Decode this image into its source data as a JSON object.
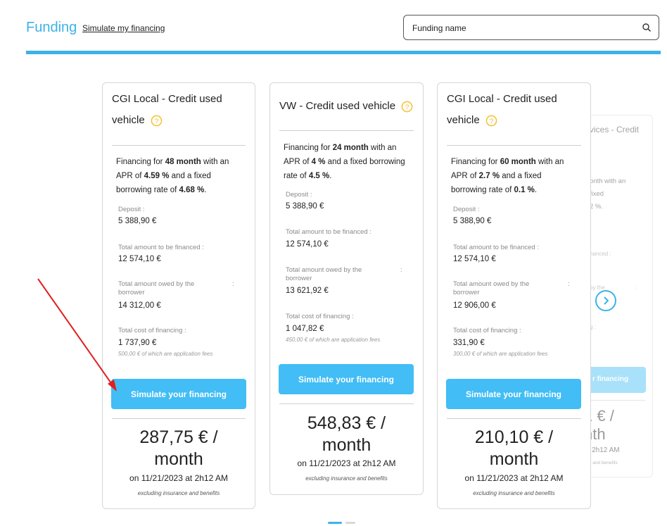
{
  "header": {
    "title": "Funding",
    "simulate_link": "Simulate my financing",
    "search_placeholder": "Funding name"
  },
  "colors": {
    "accent": "#3db2e8",
    "button": "#42bdf5",
    "help_icon": "#f2c12e",
    "arrow": "#e02020"
  },
  "labels": {
    "deposit": "Deposit :",
    "total_financed": "Total amount to be financed :",
    "total_owed_1": "Total amount owed by the",
    "total_owed_2": "borrower",
    "total_owed_colon": ":",
    "cost": "Total cost of financing :",
    "button": "Simulate your financing",
    "exclusion": "excluding insurance and benefits",
    "month": "month"
  },
  "cards": [
    {
      "title_line1": "CGI Local - Credit used",
      "title_line2": "vehicle",
      "months": "48 month",
      "apr": "4.59 %",
      "rate": "4.68 %",
      "deposit": "5 388,90 €",
      "financed": "12 574,10 €",
      "owed": "14 312,00 €",
      "cost": "1 737,90 €",
      "fees_note": "500,00 € of which are application fees",
      "price": "287,75 € /",
      "date": "on 11/21/2023 at 2h12 AM"
    },
    {
      "title_line1": "VW - Credit used vehicle",
      "months": "24 month",
      "apr": "4 %",
      "rate": "4.5 %",
      "deposit": "5 388,90 €",
      "financed": "12 574,10 €",
      "owed": "13 621,92 €",
      "cost": "1 047,82 €",
      "fees_note": "450,00 € of which are application fees",
      "price": "548,83 € /",
      "date": "on 11/21/2023 at 2h12 AM"
    },
    {
      "title_line1": "CGI Local - Credit used",
      "title_line2": "vehicle",
      "months": "60 month",
      "apr": "2.7 %",
      "rate": "0.1 %",
      "deposit": "5 388,90 €",
      "financed": "12 574,10 €",
      "owed": "12 906,00 €",
      "cost": "331,90 €",
      "fees_note": "300,00 € of which are application fees",
      "price": "210,10 € /",
      "date": "on 11/21/2023 at 2h12 AM"
    }
  ],
  "faded_card": {
    "title": "rvices - Credit",
    "line1": "onth with an",
    "line2": "fixed",
    "line3": "2 %.",
    "financed_frag": "nanced :",
    "owed_frag": "by the",
    "owed_colon": ":",
    "cost_frag": "g :",
    "button_frag": "r financing",
    "price_frag": "1 € /",
    "month_frag": "nth",
    "date_frag": "at 2h12 AM",
    "excl_frag": "nce and benefits"
  },
  "text_parts": {
    "fin_for": "Financing for",
    "with_an": "with an",
    "apr_of": "APR of",
    "and_fixed": "and a fixed",
    "borrowing_rate": "borrowing rate of",
    "period": "."
  }
}
